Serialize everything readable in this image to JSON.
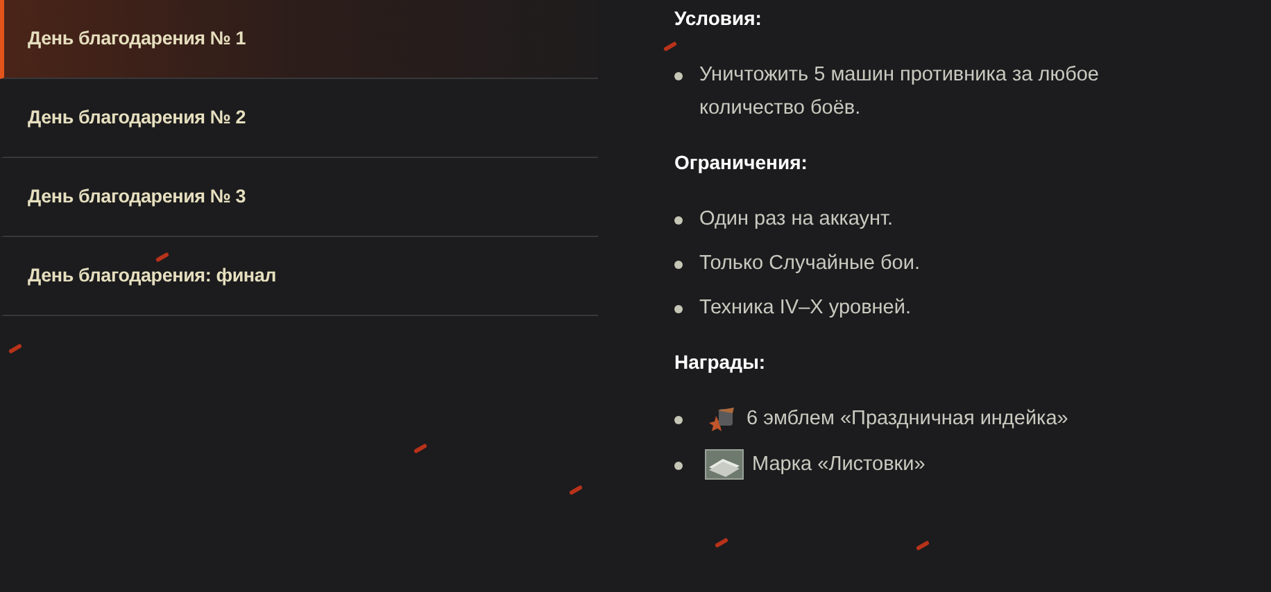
{
  "menu": [
    {
      "label": "День благодарения № 1",
      "selected": true
    },
    {
      "label": "День благодарения № 2",
      "selected": false
    },
    {
      "label": "День благодарения № 3",
      "selected": false
    },
    {
      "label": "День благодарения: финал",
      "selected": false
    }
  ],
  "sections": [
    {
      "title": "Условия:",
      "items": [
        {
          "kind": "plain",
          "text": "Уничтожить 5 машин противника за любое количество боёв."
        }
      ]
    },
    {
      "title": "Ограничения:",
      "items": [
        {
          "kind": "plain",
          "text": "Один раз на аккаунт."
        },
        {
          "kind": "plain",
          "text": "Только Случайные бои."
        },
        {
          "kind": "plain",
          "text": "Техника IV–X уровней."
        }
      ]
    },
    {
      "title": "Награды:",
      "items": [
        {
          "kind": "emblem",
          "text": "6 эмблем «Праздничная индейка»"
        },
        {
          "kind": "stamp",
          "text": "Марка «Листовки»"
        }
      ]
    }
  ]
}
